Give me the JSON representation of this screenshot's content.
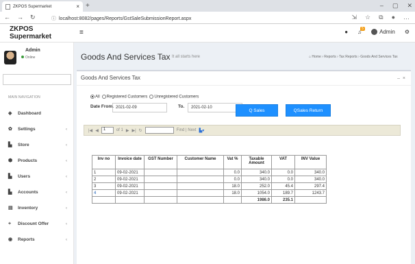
{
  "browser": {
    "tab_title": "ZKPOS Supermarket",
    "url": "localhost:8082/pages/Reports/GstSaleSubmissionReport.aspx"
  },
  "app": {
    "logo": "ZKPOS Supermarket",
    "user": "Admin",
    "status": "Online",
    "header_user": "Admin"
  },
  "sidebar": {
    "nav_header": "MAIN NAVIGATION",
    "items": [
      {
        "label": "Dashboard",
        "icon": "dashboard-icon"
      },
      {
        "label": "Settings",
        "icon": "gear-icon"
      },
      {
        "label": "Store",
        "icon": "store-icon"
      },
      {
        "label": "Products",
        "icon": "products-icon"
      },
      {
        "label": "Users",
        "icon": "users-icon"
      },
      {
        "label": "Accounts",
        "icon": "accounts-icon"
      },
      {
        "label": "Inventory",
        "icon": "inventory-icon"
      },
      {
        "label": "Discount Offer",
        "icon": "plus-icon"
      },
      {
        "label": "Reports",
        "icon": "reports-icon"
      }
    ]
  },
  "page": {
    "title": "Goods And Services Tax",
    "subtitle": "It all starts here",
    "breadcrumb": [
      "Home",
      "Reports",
      "Tax Reports",
      "Goods And Services Tax"
    ]
  },
  "box": {
    "title": "Goods And Services Tax"
  },
  "filters": {
    "radio_all": "All",
    "radio_registered": "Registered Customers",
    "radio_unregistered": "Unregistered Customers",
    "date_from_label": "Date From.",
    "date_from": "2021-02-09",
    "date_to_label": "To.",
    "date_to": "2021-02-10",
    "sales_button": "Q Sales",
    "sales_return_button": "QSales Return"
  },
  "report_viewer": {
    "page": "1",
    "of_pages": "of 1",
    "find_next": "Find | Next"
  },
  "table": {
    "headers": [
      "Inv no",
      "Invoice date",
      "GST Number",
      "Customer Name",
      "Vat %",
      "Taxable Amount",
      "VAT",
      "INV Value"
    ],
    "rows": [
      [
        "1",
        "09-02-2021",
        "",
        "",
        "0.0",
        "340.0",
        "0.0",
        "340.0"
      ],
      [
        "2",
        "09-02-2021",
        "",
        "",
        "0.0",
        "340.0",
        "0.0",
        "340.0"
      ],
      [
        "3",
        "09-02-2021",
        "",
        "",
        "18.0",
        "252.0",
        "45.4",
        "297.4"
      ],
      [
        "4",
        "09-02-2021",
        "",
        "",
        "18.0",
        "1054.0",
        "189.7",
        "1243.7"
      ]
    ],
    "totals": {
      "taxable": "1986.0",
      "vat": "235.1"
    }
  }
}
